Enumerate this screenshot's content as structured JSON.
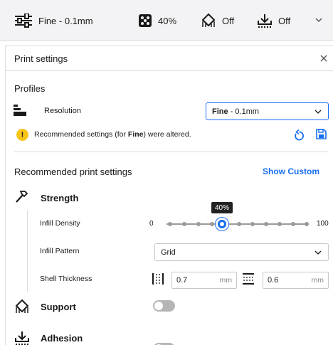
{
  "topbar": {
    "profile_label": "Fine - 0.1mm",
    "infill_label": "40%",
    "support_label": "Off",
    "adhesion_label": "Off"
  },
  "panel": {
    "title": "Print settings",
    "close_icon": "close-icon"
  },
  "profiles": {
    "section_label": "Profiles",
    "resolution_label": "Resolution",
    "resolution_value_bold": "Fine",
    "resolution_value_rest": " - 0.1mm"
  },
  "warning": {
    "text_prefix": "Recommended settings (for ",
    "text_bold": "Fine",
    "text_suffix": ") were altered."
  },
  "recommended": {
    "title": "Recommended print settings",
    "show_custom": "Show Custom"
  },
  "strength": {
    "label": "Strength",
    "infill_density_label": "Infill Density",
    "slider_min": "0",
    "slider_max": "100",
    "slider_value": 40,
    "slider_tooltip": "40%",
    "infill_pattern_label": "Infill Pattern",
    "infill_pattern_value": "Grid",
    "shell_thickness_label": "Shell Thickness",
    "wall_value": "0.7",
    "wall_unit": "mm",
    "topbottom_value": "0.6",
    "topbottom_unit": "mm"
  },
  "support": {
    "label": "Support",
    "enabled": false
  },
  "adhesion": {
    "label": "Adhesion",
    "enabled": false
  },
  "colors": {
    "accent": "#196ef0",
    "warning": "#f5c518",
    "toggle_off": "#b5b5b5"
  }
}
